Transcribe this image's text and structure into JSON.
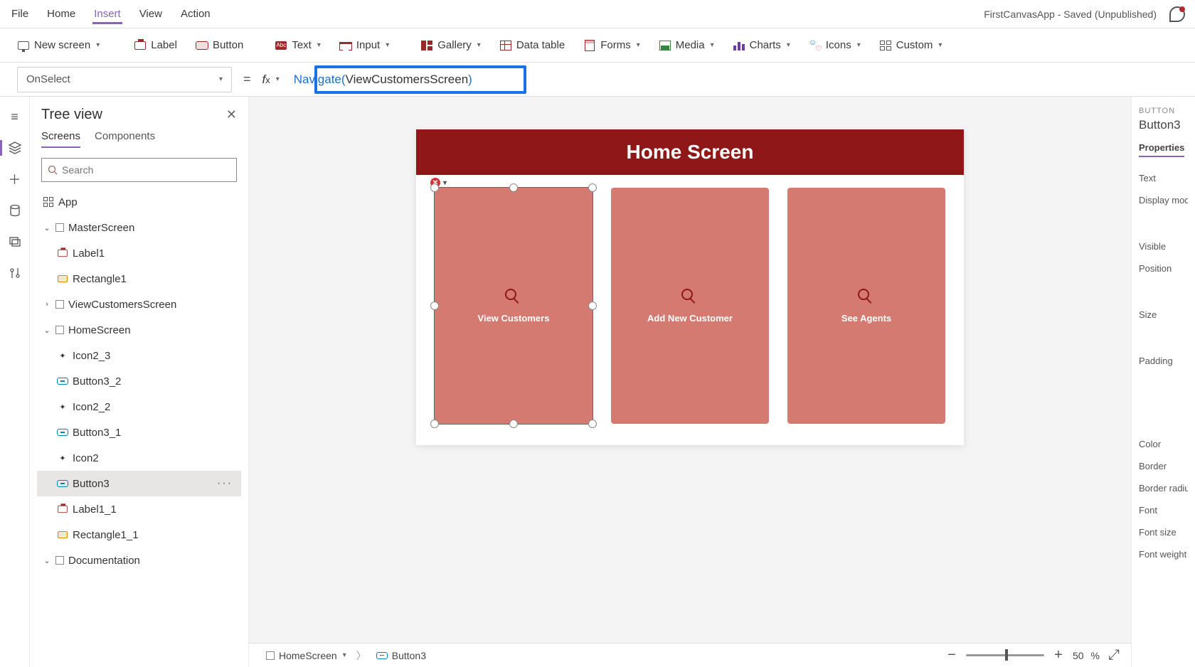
{
  "topmenu": {
    "items": [
      "File",
      "Home",
      "Insert",
      "View",
      "Action"
    ],
    "active": 2
  },
  "app_title": "FirstCanvasApp - Saved (Unpublished)",
  "ribbon": {
    "new_screen": "New screen",
    "label": "Label",
    "button": "Button",
    "text": "Text",
    "input": "Input",
    "gallery": "Gallery",
    "data_table": "Data table",
    "forms": "Forms",
    "media": "Media",
    "charts": "Charts",
    "icons": "Icons",
    "custom": "Custom"
  },
  "formula": {
    "property": "OnSelect",
    "fn": "Navigate",
    "arg": "ViewCustomersScreen"
  },
  "tree": {
    "title": "Tree view",
    "tabs": {
      "screens": "Screens",
      "components": "Components"
    },
    "search_placeholder": "Search",
    "items": {
      "app": "App",
      "master": "MasterScreen",
      "master_children": [
        "Label1",
        "Rectangle1"
      ],
      "viewcustomers": "ViewCustomersScreen",
      "home": "HomeScreen",
      "home_children": [
        "Icon2_3",
        "Button3_2",
        "Icon2_2",
        "Button3_1",
        "Icon2",
        "Button3",
        "Label1_1",
        "Rectangle1_1"
      ],
      "documentation": "Documentation"
    },
    "selected": "Button3"
  },
  "canvas": {
    "header": "Home Screen",
    "cards": [
      {
        "label": "View Customers"
      },
      {
        "label": "Add New Customer"
      },
      {
        "label": "See Agents"
      }
    ]
  },
  "breadcrumb": {
    "screen": "HomeScreen",
    "control": "Button3"
  },
  "zoom": {
    "value": "50",
    "unit": "%"
  },
  "properties": {
    "type": "BUTTON",
    "name": "Button3",
    "tab": "Properties",
    "rows": [
      "Text",
      "Display mod",
      "",
      "Visible",
      "Position",
      "",
      "Size",
      "",
      "Padding",
      "",
      "",
      "",
      "Color",
      "",
      "Border",
      "",
      "Border radiu",
      "",
      "Font",
      "",
      "Font size",
      "",
      "Font weight"
    ]
  }
}
